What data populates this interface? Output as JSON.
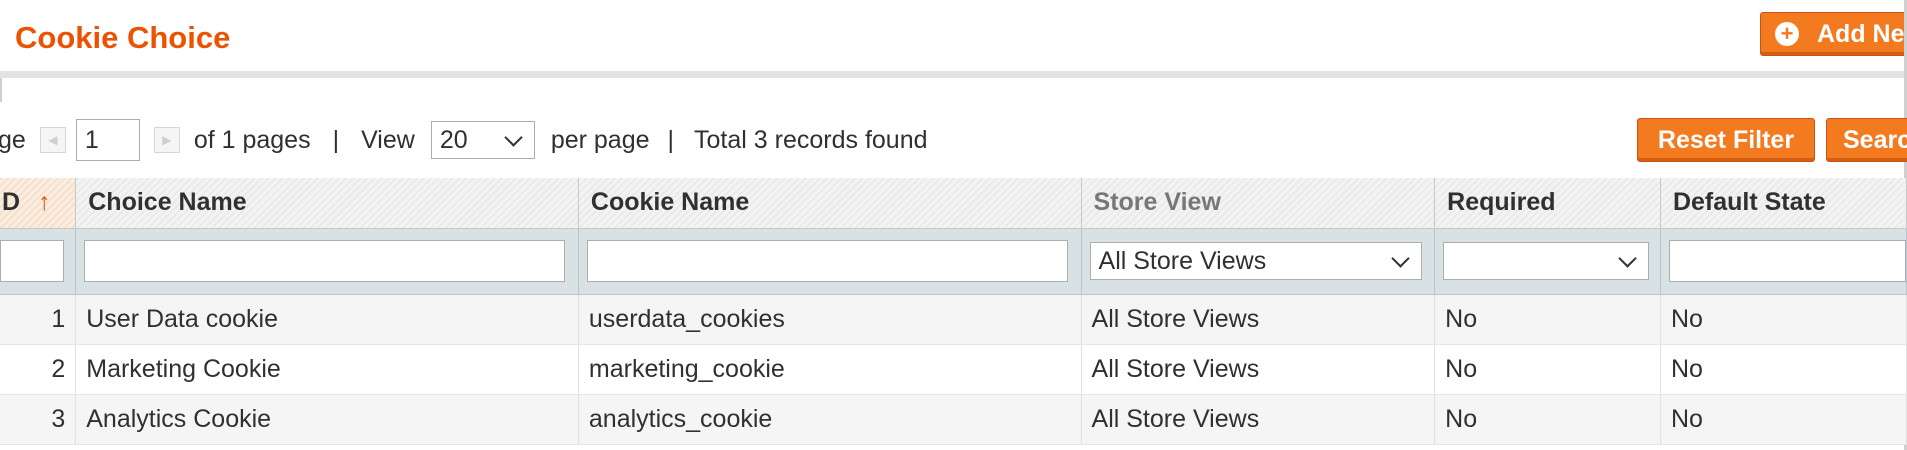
{
  "header": {
    "title": "Cookie Choice",
    "add_button_label": "Add Ne"
  },
  "pager": {
    "page_label": "ge",
    "page_value": "1",
    "of_pages": "of 1 pages",
    "separator": "|",
    "view_label": "View",
    "per_page_value": "20",
    "per_page_label": "per page",
    "total_records": "Total 3 records found"
  },
  "actions": {
    "reset_filter": "Reset Filter",
    "search": "Searc"
  },
  "grid": {
    "columns": [
      "D",
      "Choice Name",
      "Cookie Name",
      "Store View",
      "Required",
      "Default State"
    ],
    "sort_arrow": "↑",
    "filters": {
      "store_view": "All Store Views"
    },
    "rows": [
      {
        "id": "1",
        "choice_name": "User Data cookie",
        "cookie_name": "userdata_cookies",
        "store_view": "All Store Views",
        "required": "No",
        "default_state": "No"
      },
      {
        "id": "2",
        "choice_name": "Marketing Cookie",
        "cookie_name": "marketing_cookie",
        "store_view": "All Store Views",
        "required": "No",
        "default_state": "No"
      },
      {
        "id": "3",
        "choice_name": "Analytics Cookie",
        "cookie_name": "analytics_cookie",
        "store_view": "All Store Views",
        "required": "No",
        "default_state": "No"
      }
    ]
  },
  "colors": {
    "accent": "#eb5202",
    "button": "#f47a20",
    "filter_row": "#d8e1e3"
  },
  "icons": {
    "add": "plus-circle-icon",
    "prev": "arrow-left-icon",
    "next": "arrow-right-icon",
    "dropdown": "chevron-down-icon",
    "sort": "sort-asc-icon"
  }
}
